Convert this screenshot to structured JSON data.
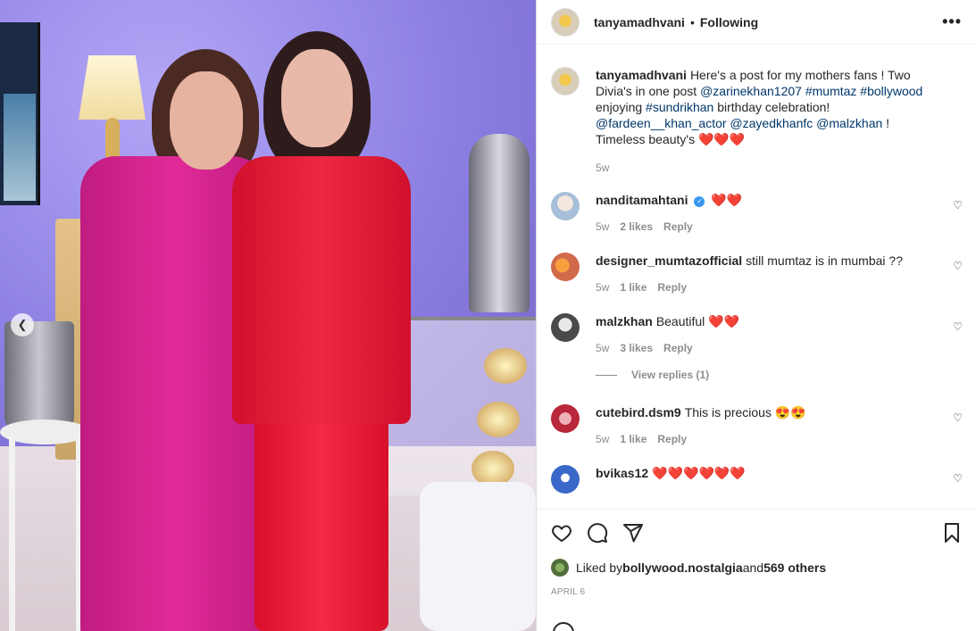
{
  "post": {
    "author": "tanyamadhvani",
    "separator": "•",
    "follow_status": "Following",
    "more_icon": "more-horizontal-icon"
  },
  "caption": {
    "username": "tanyamadhvani",
    "text_1": "Here's a post for my mothers fans ! Two Divia's in one post ",
    "mention_1": "@zarinekhan1207",
    "hashtag_1": "#mumtaz",
    "hashtag_2": "#bollywood",
    "text_2": " enjoying ",
    "hashtag_3": "#sundrikhan",
    "text_3": " birthday celebration! ",
    "mention_2": "@fardeen__khan_actor",
    "mention_3": "@zayedkhanfc",
    "mention_4": "@malzkhan",
    "text_4": " ! Timeless beauty's ",
    "hearts": "❤️❤️❤️",
    "time": "5w"
  },
  "comments": [
    {
      "username": "nanditamahtani",
      "verified": true,
      "text": "",
      "emoji": "❤️❤️",
      "time": "5w",
      "likes": "2 likes",
      "reply": "Reply"
    },
    {
      "username": "designer_mumtazofficial",
      "verified": false,
      "text": "still mumtaz is in mumbai ??",
      "emoji": "",
      "time": "5w",
      "likes": "1 like",
      "reply": "Reply"
    },
    {
      "username": "malzkhan",
      "verified": false,
      "text": "Beautiful ",
      "emoji": "❤️❤️",
      "time": "5w",
      "likes": "3 likes",
      "reply": "Reply",
      "view_replies": "View replies (1)"
    },
    {
      "username": "cutebird.dsm9",
      "verified": false,
      "text": "This is precious ",
      "emoji": "😍😍",
      "time": "5w",
      "likes": "1 like",
      "reply": "Reply"
    },
    {
      "username": "bvikas12",
      "verified": false,
      "text": "",
      "emoji": "❤️❤️❤️❤️❤️❤️",
      "time": "",
      "likes": "",
      "reply": ""
    }
  ],
  "likes": {
    "prefix": "Liked by ",
    "user": "bollywood.nostalgia",
    "middle": " and ",
    "others": "569 others"
  },
  "date": "APRIL 6",
  "colors": {
    "link": "#00376b",
    "heart": "#ed1c24",
    "verified": "#3897f0"
  }
}
